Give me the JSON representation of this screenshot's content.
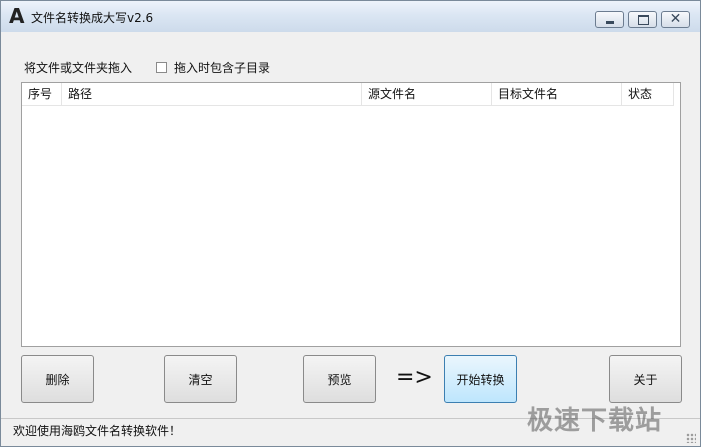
{
  "window": {
    "title": "文件名转换成大写v2.6",
    "icon_glyph": "A",
    "controls": {
      "minimize": "minimize-icon",
      "maximize": "maximize-icon",
      "close_glyph": "✕"
    }
  },
  "drop_area": {
    "label": "将文件或文件夹拖入",
    "include_subdirs_label": "拖入时包含子目录",
    "include_subdirs_checked": false
  },
  "file_list": {
    "columns": [
      "序号",
      "路径",
      "源文件名",
      "目标文件名",
      "状态"
    ],
    "rows": []
  },
  "buttons": {
    "delete": "删除",
    "clear": "清空",
    "preview": "预览",
    "arrow": "=>",
    "start": "开始转换",
    "about": "关于"
  },
  "status_bar": {
    "text": "欢迎使用海鸥文件名转换软件！"
  },
  "watermark": "极速下载站",
  "colors": {
    "primary_button_border": "#3c7fb1",
    "primary_button_fill": "#bee6fd"
  }
}
